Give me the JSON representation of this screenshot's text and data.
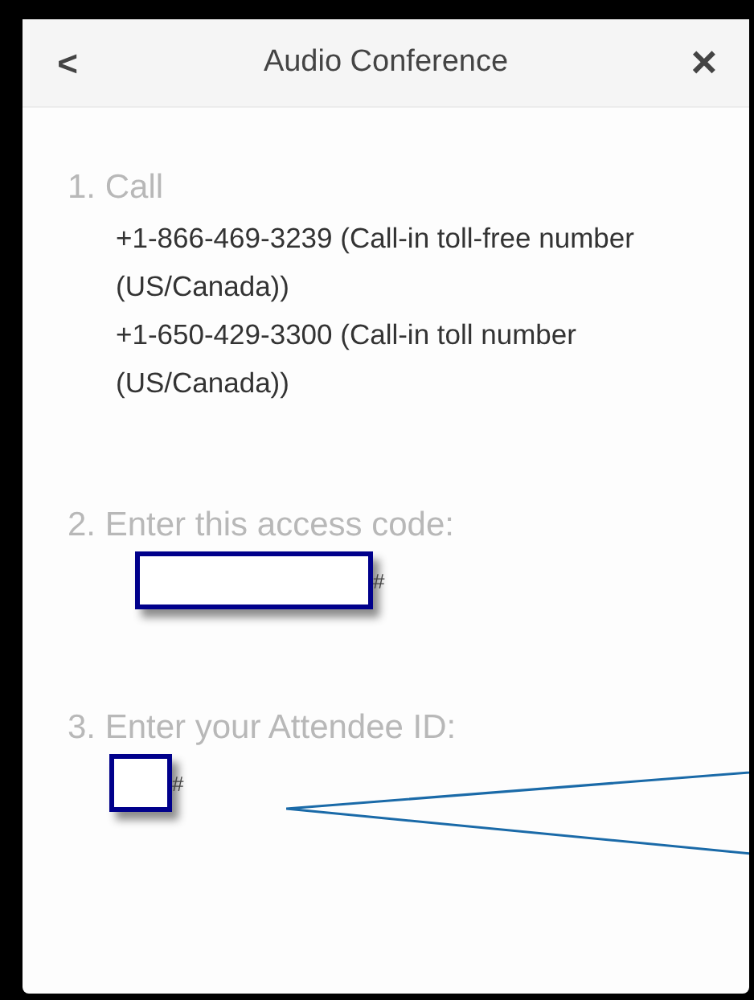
{
  "header": {
    "back": "<",
    "title": "Audio Conference",
    "close": "×"
  },
  "steps": [
    {
      "kind": "numbers",
      "label": "1. Call",
      "numbers": [
        "+1-866-469-3239 (Call-in toll-free number (US/Canada))",
        "+1-650-429-3300 (Call-in toll number (US/Canada))"
      ]
    },
    {
      "kind": "field",
      "label": "2. Enter this access code:",
      "suffix": "#",
      "callout": false
    },
    {
      "kind": "box",
      "label": "3. Enter your Attendee ID:",
      "suffix": "#",
      "callout": true
    }
  ]
}
